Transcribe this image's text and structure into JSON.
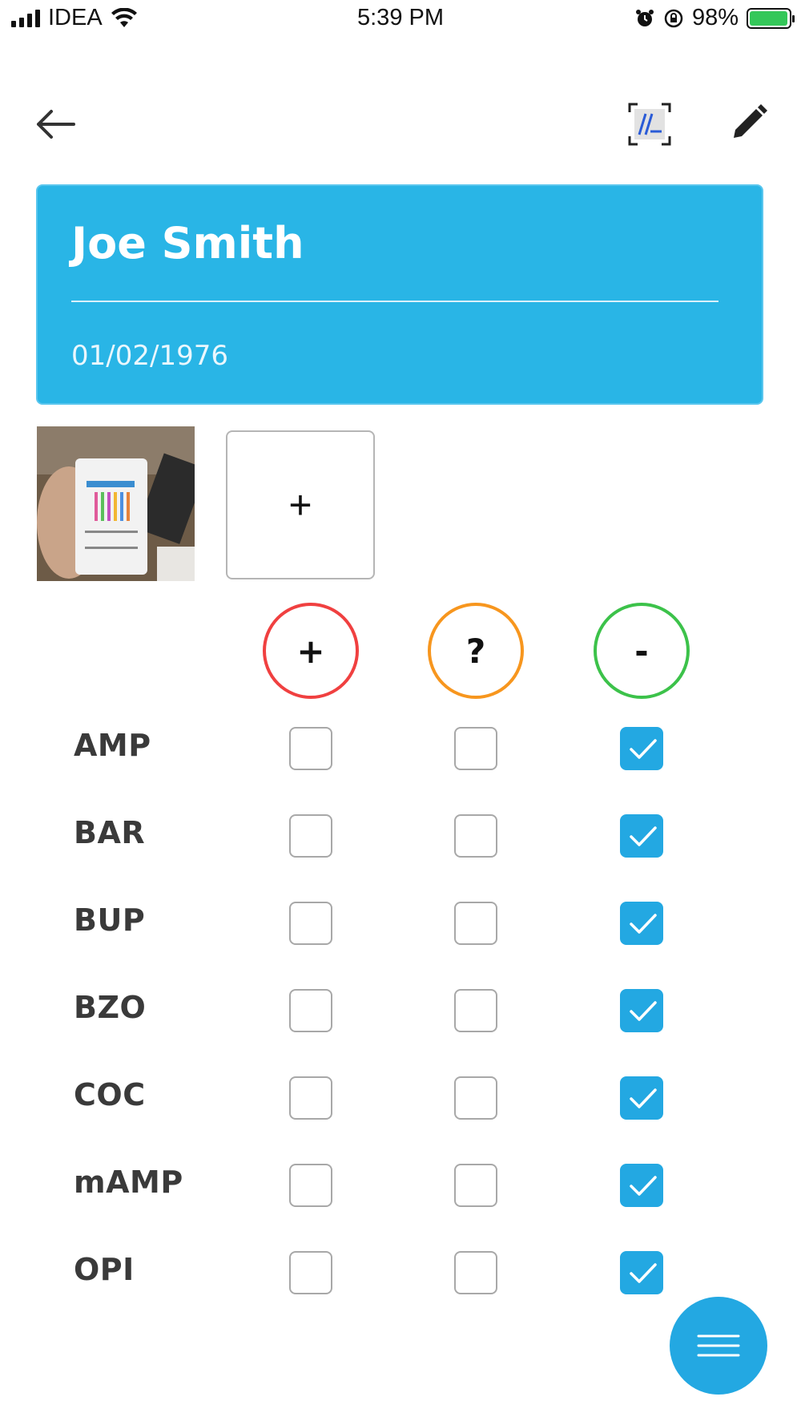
{
  "status_bar": {
    "carrier": "IDEA",
    "time": "5:39 PM",
    "battery_percent": "98%",
    "battery_level": 0.98,
    "icons": [
      "signal-icon",
      "wifi-icon",
      "alarm-icon",
      "rotation-lock-icon",
      "battery-charging-icon"
    ]
  },
  "toolbar": {
    "back_icon": "arrow-left-icon",
    "scan_icon": "signature-scan-icon",
    "edit_icon": "pencil-icon"
  },
  "patient": {
    "name": "Joe Smith",
    "dob": "01/02/1976"
  },
  "photos": {
    "add_label": "+"
  },
  "result_columns": [
    {
      "symbol": "+",
      "color": "#f04040"
    },
    {
      "symbol": "?",
      "color": "#f7961e"
    },
    {
      "symbol": "-",
      "color": "#3cc24a"
    }
  ],
  "tests": [
    {
      "label": "AMP",
      "result": 2
    },
    {
      "label": "BAR",
      "result": 2
    },
    {
      "label": "BUP",
      "result": 2
    },
    {
      "label": "BZO",
      "result": 2
    },
    {
      "label": "COC",
      "result": 2
    },
    {
      "label": "mAMP",
      "result": 2
    },
    {
      "label": "OPI",
      "result": 2
    }
  ],
  "fab": {
    "icon": "menu-lines-icon"
  },
  "colors": {
    "accent": "#23a8e2",
    "card": "#29b5e6",
    "positive": "#f04040",
    "inconclusive": "#f7961e",
    "negative": "#3cc24a"
  }
}
